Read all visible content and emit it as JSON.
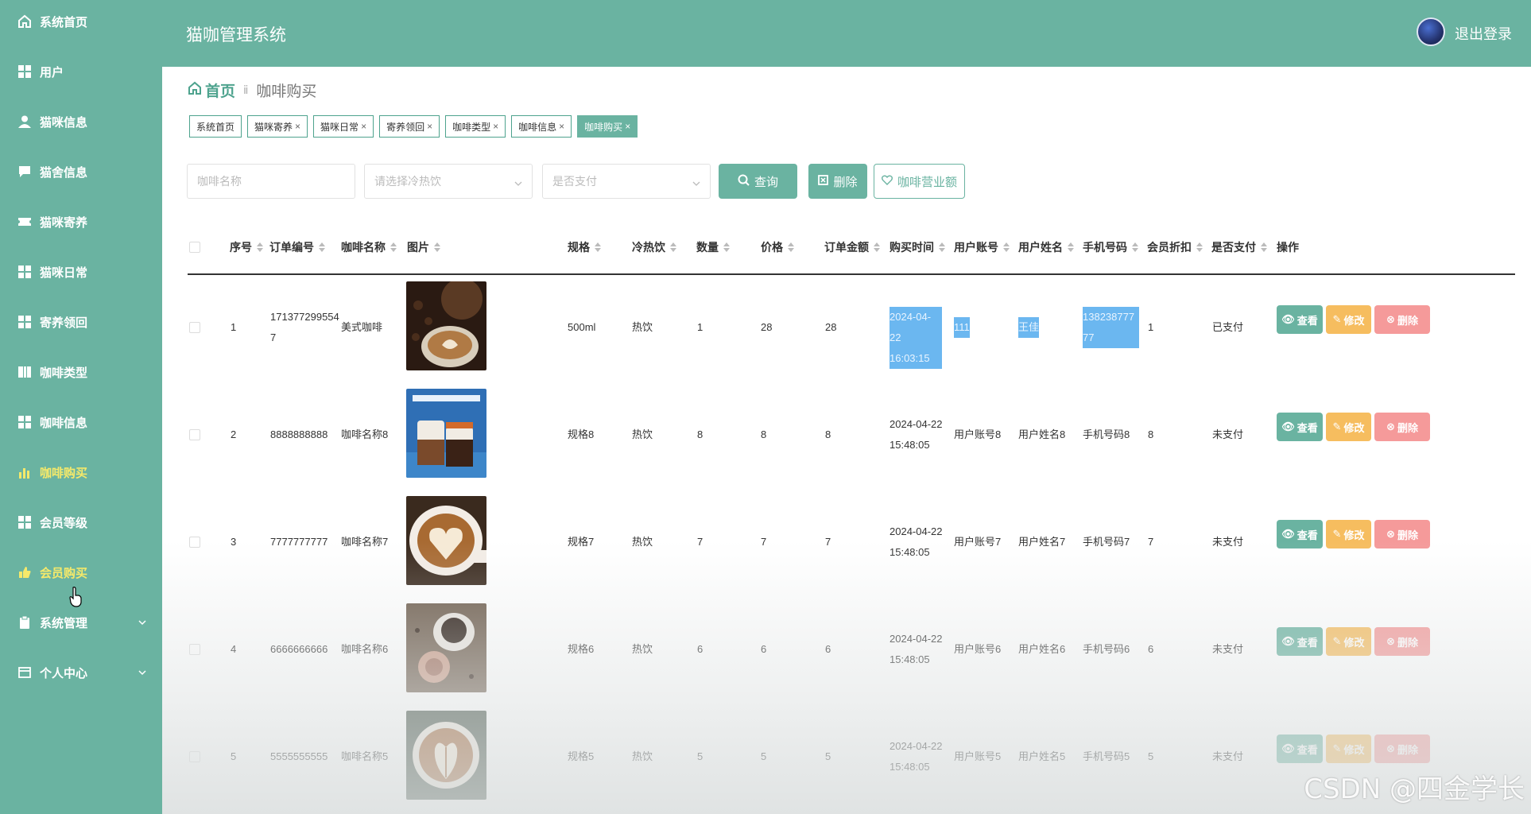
{
  "header": {
    "app_title": "猫咖管理系统",
    "logout_label": "退出登录"
  },
  "sidebar": {
    "items": [
      {
        "label": "系统首页",
        "icon": "home-icon"
      },
      {
        "label": "用户",
        "icon": "grid-icon"
      },
      {
        "label": "猫咪信息",
        "icon": "user-icon"
      },
      {
        "label": "猫舍信息",
        "icon": "chat-icon"
      },
      {
        "label": "猫咪寄养",
        "icon": "ticket-icon"
      },
      {
        "label": "猫咪日常",
        "icon": "grid-icon"
      },
      {
        "label": "寄养领回",
        "icon": "grid-icon"
      },
      {
        "label": "咖啡类型",
        "icon": "book-icon"
      },
      {
        "label": "咖啡信息",
        "icon": "grid-icon"
      },
      {
        "label": "咖啡购买",
        "icon": "bar-chart-icon",
        "active": true
      },
      {
        "label": "会员等级",
        "icon": "grid-icon"
      },
      {
        "label": "会员购买",
        "icon": "hand-icon"
      },
      {
        "label": "系统管理",
        "icon": "clipboard-icon",
        "expandable": true
      },
      {
        "label": "个人中心",
        "icon": "window-icon",
        "expandable": true
      }
    ]
  },
  "breadcrumb": {
    "home": "首页",
    "separator": "ⅱ",
    "current": "咖啡购买"
  },
  "tags": [
    {
      "label": "系统首页",
      "closable": false
    },
    {
      "label": "猫咪寄养",
      "closable": true
    },
    {
      "label": "猫咪日常",
      "closable": true
    },
    {
      "label": "寄养领回",
      "closable": true
    },
    {
      "label": "咖啡类型",
      "closable": true
    },
    {
      "label": "咖啡信息",
      "closable": true
    },
    {
      "label": "咖啡购买",
      "closable": true,
      "active": true
    }
  ],
  "search": {
    "name_placeholder": "咖啡名称",
    "temp_placeholder": "请选择冷热饮",
    "paid_placeholder": "是否支付",
    "query_label": "查询",
    "delete_label": "删除",
    "revenue_label": "咖啡营业额"
  },
  "table": {
    "columns": [
      "序号",
      "订单编号",
      "咖啡名称",
      "图片",
      "规格",
      "冷热饮",
      "数量",
      "价格",
      "订单金额",
      "购买时间",
      "用户账号",
      "用户姓名",
      "手机号码",
      "会员折扣",
      "是否支付",
      "操作"
    ],
    "rows": [
      {
        "index": "1",
        "order_no": "1713772995547",
        "name": "美式咖啡",
        "spec": "500ml",
        "temp": "热饮",
        "qty": "1",
        "price": "28",
        "amount": "28",
        "time": "2024-04-22 16:03:15",
        "account": "111",
        "username": "王佳",
        "phone": "13823877777",
        "discount": "1",
        "paid": "已支付"
      },
      {
        "index": "2",
        "order_no": "8888888888",
        "name": "咖啡名称8",
        "spec": "规格8",
        "temp": "热饮",
        "qty": "8",
        "price": "8",
        "amount": "8",
        "time": "2024-04-22 15:48:05",
        "account": "用户账号8",
        "username": "用户姓名8",
        "phone": "手机号码8",
        "discount": "8",
        "paid": "未支付"
      },
      {
        "index": "3",
        "order_no": "7777777777",
        "name": "咖啡名称7",
        "spec": "规格7",
        "temp": "热饮",
        "qty": "7",
        "price": "7",
        "amount": "7",
        "time": "2024-04-22 15:48:05",
        "account": "用户账号7",
        "username": "用户姓名7",
        "phone": "手机号码7",
        "discount": "7",
        "paid": "未支付"
      },
      {
        "index": "4",
        "order_no": "6666666666",
        "name": "咖啡名称6",
        "spec": "规格6",
        "temp": "热饮",
        "qty": "6",
        "price": "6",
        "amount": "6",
        "time": "2024-04-22 15:48:05",
        "account": "用户账号6",
        "username": "用户姓名6",
        "phone": "手机号码6",
        "discount": "6",
        "paid": "未支付"
      },
      {
        "index": "5",
        "order_no": "5555555555",
        "name": "咖啡名称5",
        "spec": "规格5",
        "temp": "热饮",
        "qty": "5",
        "price": "5",
        "amount": "5",
        "time": "2024-04-22 15:48:05",
        "account": "用户账号5",
        "username": "用户姓名5",
        "phone": "手机号码5",
        "discount": "5",
        "paid": "未支付"
      }
    ],
    "actions": {
      "view": "查看",
      "edit": "修改",
      "delete": "删除"
    }
  },
  "watermark": "CSDN @四金学长",
  "colors": {
    "primary": "#6ab3a1",
    "edit": "#f6bd5f",
    "delete": "#f59a9a",
    "active_menu": "#f5e96a"
  }
}
